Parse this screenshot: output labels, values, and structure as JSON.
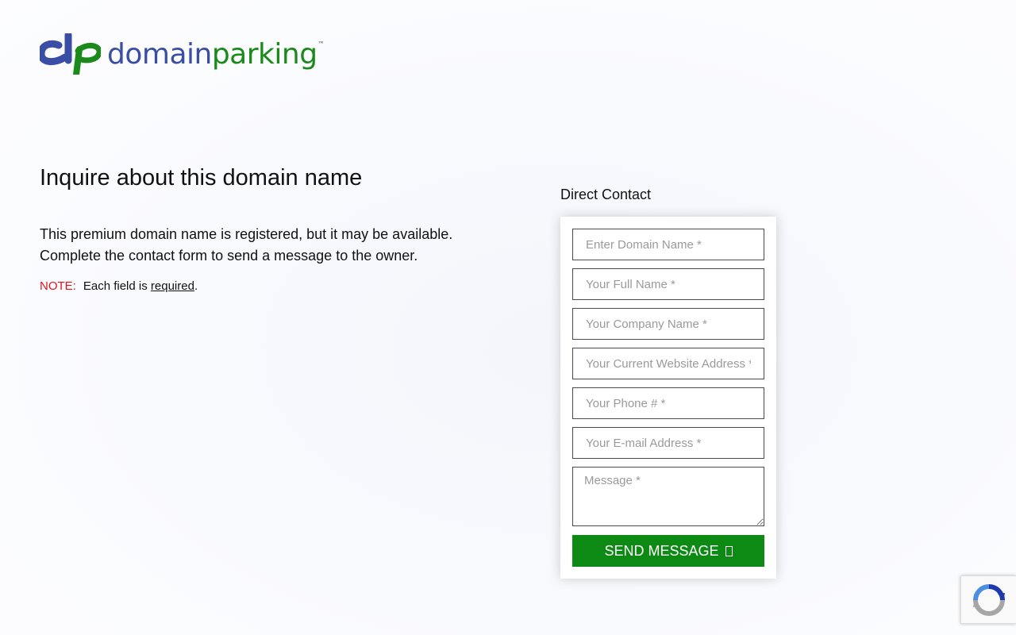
{
  "logo": {
    "text_domain": "domain",
    "text_parking": "parking",
    "trademark": "™",
    "colors": {
      "domain": "#3b4ea6",
      "parking": "#1b8a1b"
    }
  },
  "main": {
    "heading": "Inquire about this domain name",
    "intro_line1": "This premium domain name is registered, but it may be available.",
    "intro_line2": "Complete the contact form to send a message to the owner.",
    "note_label": "NOTE:",
    "note_text": "Each field is ",
    "note_required": "required",
    "note_period": "."
  },
  "contact": {
    "title": "Direct Contact",
    "fields": {
      "domain_placeholder": "Enter Domain Name *",
      "full_name_placeholder": "Your Full Name *",
      "company_placeholder": "Your Company Name *",
      "website_placeholder": "Your Current Website Address *",
      "phone_placeholder": "Your Phone # *",
      "email_placeholder": "Your E-mail Address *",
      "message_placeholder": "Message *"
    },
    "send_label": "SEND MESSAGE",
    "send_icon": "missing-glyph-icon",
    "button_color": "#0d8a13"
  },
  "badge": {
    "icon": "recaptcha-icon"
  }
}
